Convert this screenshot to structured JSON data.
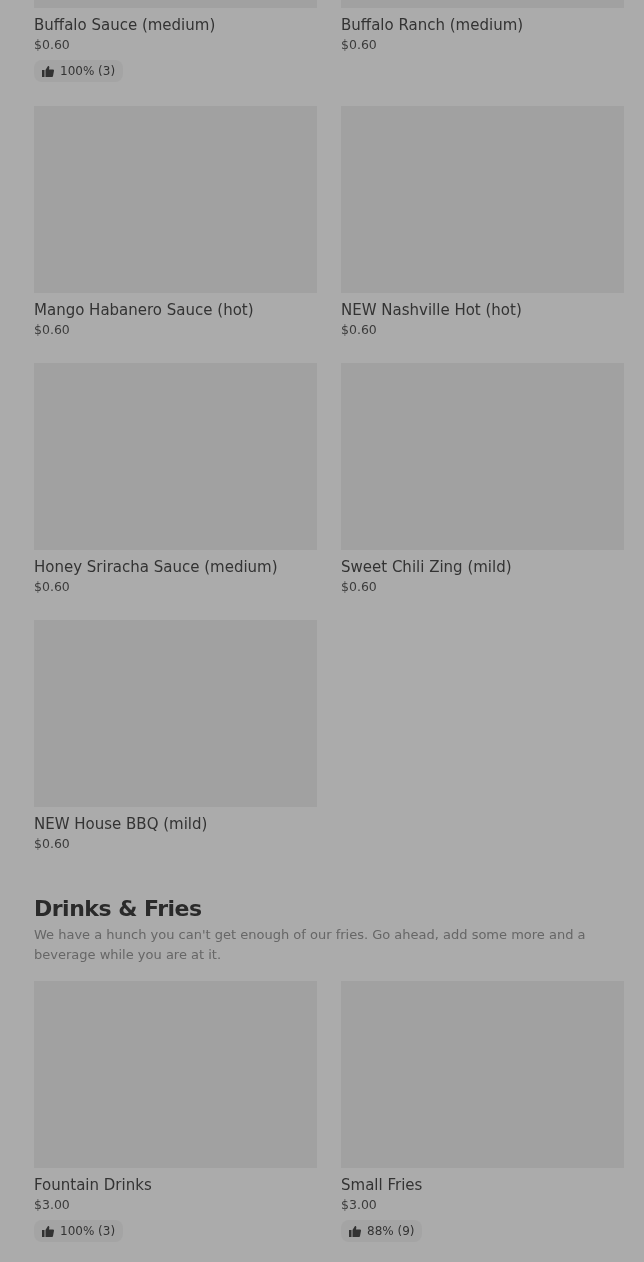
{
  "sections": [
    {
      "items": [
        {
          "name": "Buffalo Sauce (medium)",
          "price": "$0.60",
          "rating": "100% (3)"
        },
        {
          "name": "Buffalo Ranch (medium)",
          "price": "$0.60"
        },
        {
          "name": "Mango Habanero Sauce (hot)",
          "price": "$0.60"
        },
        {
          "name": "NEW Nashville Hot (hot)",
          "price": "$0.60"
        },
        {
          "name": "Honey Sriracha Sauce (medium)",
          "price": "$0.60"
        },
        {
          "name": "Sweet Chili Zing (mild)",
          "price": "$0.60"
        },
        {
          "name": "NEW House BBQ (mild)",
          "price": "$0.60"
        }
      ]
    },
    {
      "title": "Drinks & Fries",
      "description": "We have a hunch you can't get enough of our fries. Go ahead, add some more and a beverage while you are at it.",
      "items": [
        {
          "name": "Fountain Drinks",
          "price": "$3.00",
          "rating": "100% (3)"
        },
        {
          "name": "Small Fries",
          "price": "$3.00",
          "rating": "88% (9)"
        }
      ]
    }
  ]
}
